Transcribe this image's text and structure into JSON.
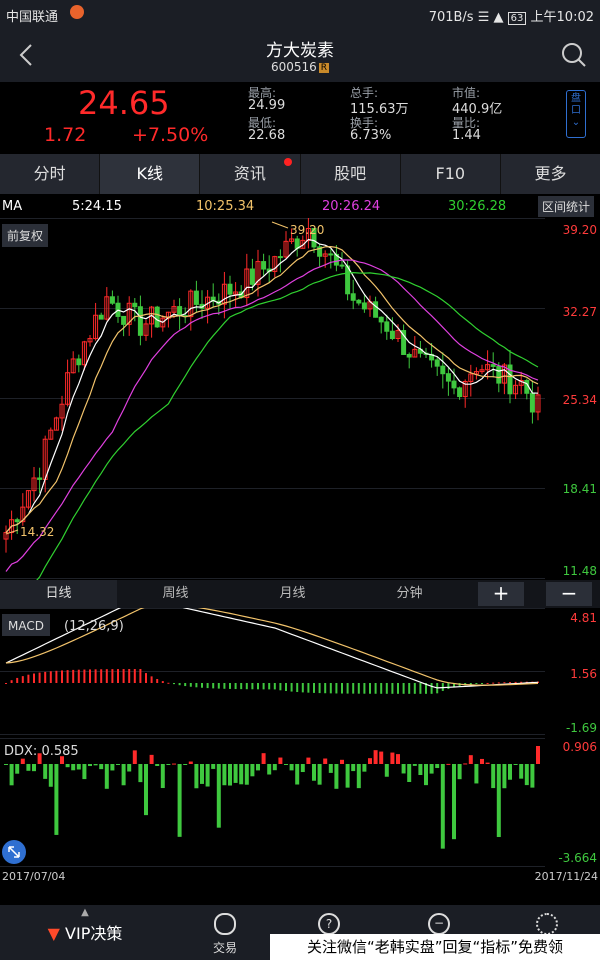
{
  "status_bar": {
    "carrier": "中国联通",
    "network_speed": "701B/s",
    "battery": "63",
    "time": "上午10:02"
  },
  "header": {
    "stock_name": "方大炭素",
    "stock_code": "600516",
    "code_badge": "R"
  },
  "quote": {
    "price": "24.65",
    "change": "1.72",
    "change_pct": "+7.50%",
    "high_label": "最高:",
    "high": "24.99",
    "low_label": "最低:",
    "low": "22.68",
    "volume_label": "总手:",
    "volume": "115.63万",
    "turnover_label": "换手:",
    "turnover": "6.73%",
    "mcap_label": "市值:",
    "mcap": "440.9亿",
    "volratio_label": "量比:",
    "volratio": "1.44",
    "side_button": "盘口"
  },
  "tabs": [
    "分时",
    "K线",
    "资讯",
    "股吧",
    "F10",
    "更多"
  ],
  "ma": {
    "label": "MA",
    "ma5": "5:24.15",
    "ma10": "10:25.34",
    "ma20": "20:26.24",
    "ma30": "30:26.28",
    "range_button": "区间统计",
    "fq_button": "前复权"
  },
  "colors": {
    "up": "#ff2a2a",
    "down": "#3fc83f",
    "ma5": "#ffffff",
    "ma10": "#f2c36b",
    "ma20": "#e040e0",
    "ma30": "#30d030"
  },
  "chart_data": [
    {
      "type": "candlestick",
      "title": "K线",
      "y_axis_labels": [
        "39.20",
        "32.27",
        "25.34",
        "18.41",
        "11.48"
      ],
      "annotations": {
        "high": "39.20",
        "low": "14.32"
      },
      "series_names": [
        "5",
        "10",
        "20",
        "30"
      ],
      "x_range": [
        "2017/07/04",
        "2017/11/24"
      ]
    },
    {
      "type": "line",
      "title": "MACD",
      "params": "(12,26,9)",
      "y_axis_labels": [
        "4.81",
        "1.56",
        "-1.69"
      ]
    },
    {
      "type": "bar",
      "title": "DDX",
      "value_label": "DDX: 0.585",
      "y_axis_labels": [
        "0.906",
        "-3.664"
      ]
    }
  ],
  "period_tabs": [
    "日线",
    "周线",
    "月线",
    "分钟"
  ],
  "zoom": {
    "plus": "+",
    "minus": "−"
  },
  "dates": {
    "start": "2017/07/04",
    "end": "2017/11/24"
  },
  "bottom_nav": {
    "vip": "VIP决策",
    "trade": "交易"
  },
  "watermark": "关注微信“老韩实盘”回复“指标”免费领"
}
